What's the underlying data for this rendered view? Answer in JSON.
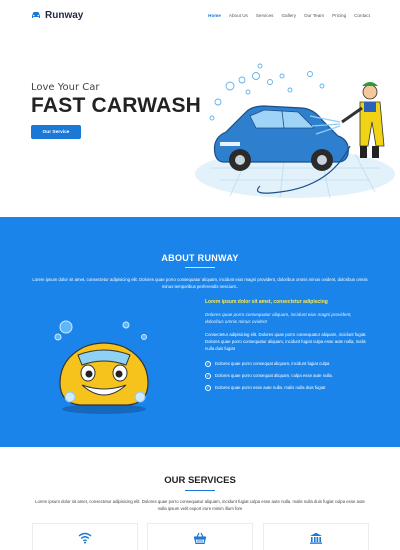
{
  "nav": {
    "brand": "Runway",
    "links": [
      "Home",
      "About Us",
      "Services",
      "Gallery",
      "Our Team",
      "Pricing",
      "Contact"
    ],
    "active": "Home"
  },
  "hero": {
    "subtitle": "Love Your Car",
    "title": "FAST CARWASH",
    "button": "Our Service"
  },
  "about": {
    "title": "ABOUT RUNWAY",
    "intro": "Lorem ipsum dolor sit amet, consectetur adipisicing elit. Dolores quae porro consequatur aliquam, incidunt eius magni provident, doloribus omnis minus ovident, doloribus omnis minus temporibus perferendis nesciunt..",
    "highlight": "Lorem ipsum dolor sit amet, consectetur adipiscing",
    "italic": "Dolores quae porro consequatur aliquam, incidunt eius magni provident, doloribus omnis minus ovident",
    "paragraph": "Consectetur adipisicing elit. Dolores quae porro consequatur aliquam, incidunt fugiat. Dolores quae porro consequatur aliquam, incidunt fugiat culpa esse aute nulla, malis nulla duis fugiat",
    "list": [
      "Dolores quae porro consequat aliquam, incidunt fugiat culpa",
      "Dolores quae porro consequat aliquam, culpa esse aute nulla.",
      "Dolores quae porro esse aute nulla. malis nulla duis fugiat"
    ]
  },
  "services": {
    "title": "OUR SERVICES",
    "intro": "Lorem ipsum dolor sit amet, consectetur adipisicing elit. Dolores quae porro consequatur aliquam, incidunt fugiat culpa esse aute nulla. malis nulla duis fugiat culpa esse aute nulla ipsum velit export irure minim illum fore",
    "cards": [
      {
        "icon": "wifi-icon"
      },
      {
        "icon": "basket-icon"
      },
      {
        "icon": "bank-icon"
      }
    ]
  },
  "colors": {
    "primary": "#1a78d6",
    "about_bg": "#1a84ea",
    "highlight": "#ffe84a"
  }
}
